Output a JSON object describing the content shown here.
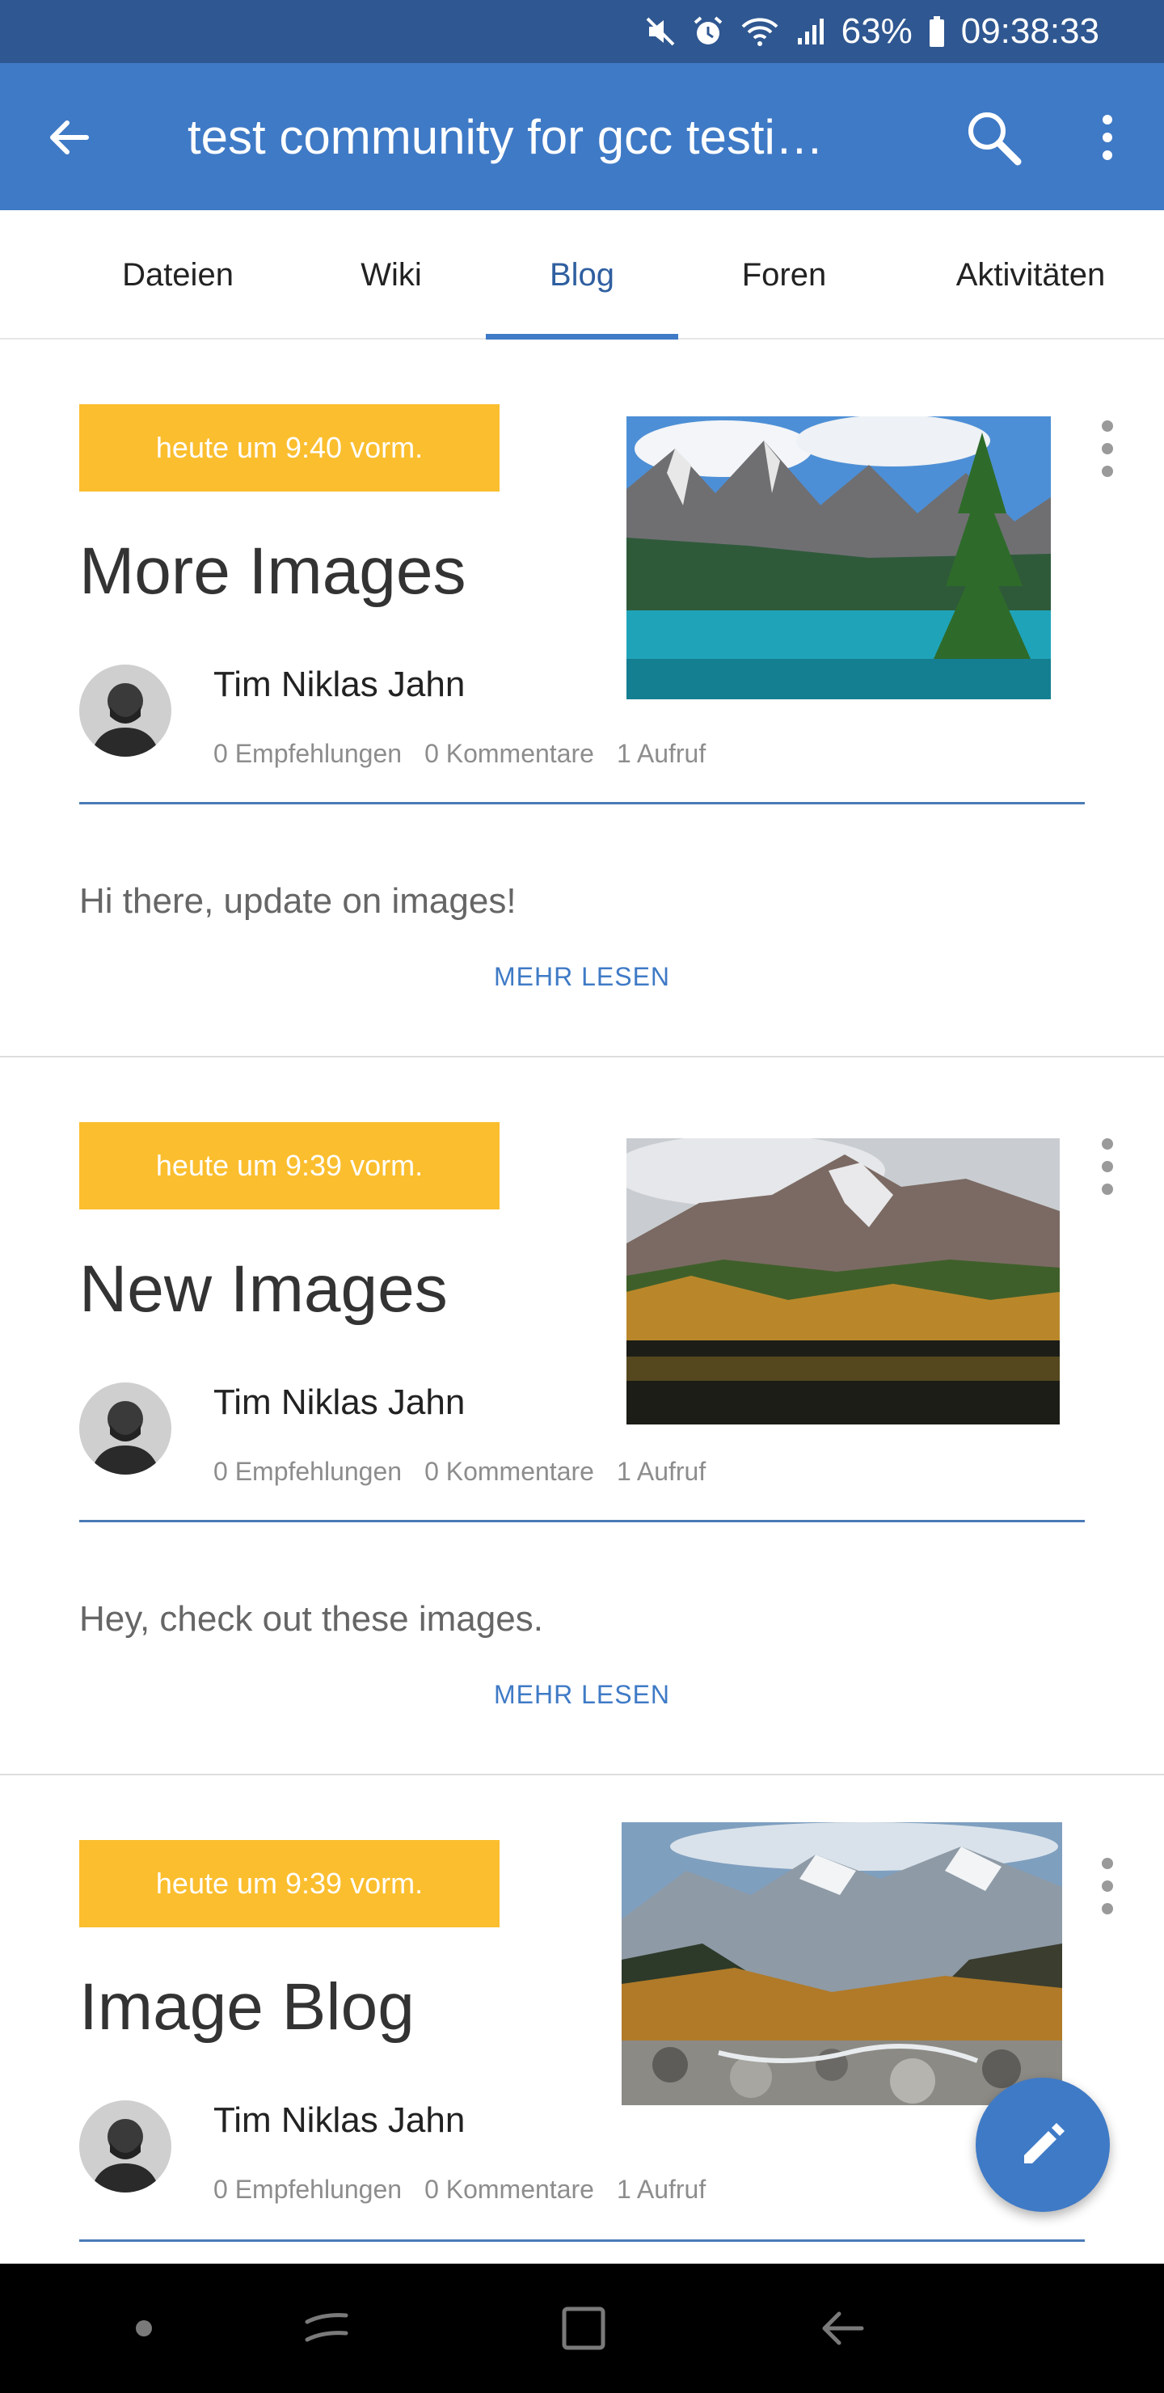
{
  "status_bar": {
    "battery": "63%",
    "time": "09:38:33",
    "icons": [
      "mute-icon",
      "alarm-icon",
      "wifi-icon",
      "signal-icon",
      "battery-icon"
    ]
  },
  "app_bar": {
    "title": "test community for gcc testi…",
    "back_icon": "arrow-left-icon",
    "search_icon": "search-icon",
    "menu_icon": "more-vert-icon"
  },
  "tabs": [
    {
      "label": "Dateien",
      "active": false
    },
    {
      "label": "Wiki",
      "active": false
    },
    {
      "label": "Blog",
      "active": true
    },
    {
      "label": "Foren",
      "active": false
    },
    {
      "label": "Aktivitäten",
      "active": false
    }
  ],
  "posts": [
    {
      "date": "heute um 9:40 vorm.",
      "title": "More Images",
      "author": "Tim Niklas Jahn",
      "recommendations": "0 Empfehlungen",
      "comments": "0 Kommentare",
      "views": "1 Aufruf",
      "excerpt": "Hi there, update on images!",
      "more_label": "MEHR LESEN",
      "image": "mountain-lake-turquoise"
    },
    {
      "date": "heute um 9:39 vorm.",
      "title": "New Images",
      "author": "Tim Niklas Jahn",
      "recommendations": "0 Empfehlungen",
      "comments": "0 Kommentare",
      "views": "1 Aufruf",
      "excerpt": "Hey, check out these images.",
      "more_label": "MEHR LESEN",
      "image": "autumn-mountain-lake"
    },
    {
      "date": "heute um 9:39 vorm.",
      "title": "Image Blog",
      "author": "Tim Niklas Jahn",
      "recommendations": "0 Empfehlungen",
      "comments": "0 Kommentare",
      "views": "1 Aufruf",
      "image": "rocky-riverbed-valley"
    }
  ],
  "fab": {
    "icon": "pencil-icon"
  },
  "nav_bar": {
    "icons": [
      "dot-icon",
      "recent-apps-icon",
      "home-icon",
      "back-icon"
    ]
  },
  "colors": {
    "status_bar": "#2f5791",
    "app_bar": "#3f7ac6",
    "accent": "#3f7ac6",
    "date_badge": "#fbbe2e",
    "nav_bar": "#000000"
  }
}
